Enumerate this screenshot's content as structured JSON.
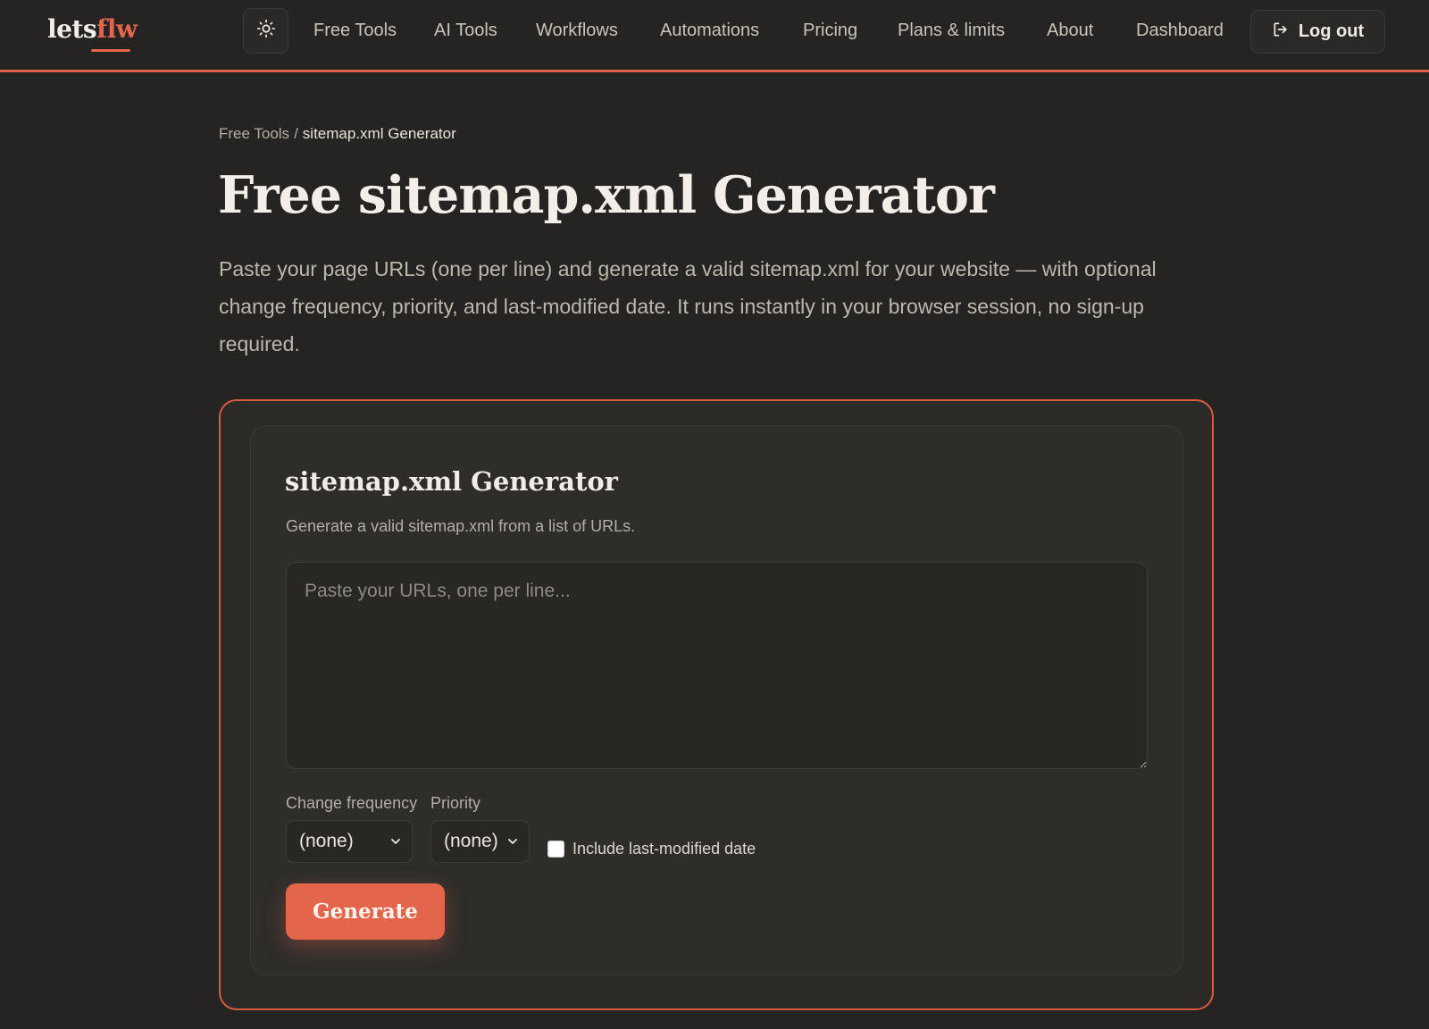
{
  "header": {
    "logo": {
      "part1": "lets",
      "part2": "flw"
    },
    "theme_toggle_icon": "sun-icon",
    "nav": [
      {
        "label": "Free Tools"
      },
      {
        "label": "AI Tools"
      },
      {
        "label": "Workflows"
      },
      {
        "label": "Automations"
      },
      {
        "label": "Pricing"
      },
      {
        "label": "Plans & limits"
      },
      {
        "label": "About"
      },
      {
        "label": "Dashboard"
      }
    ],
    "logout": {
      "label": "Log out",
      "icon": "logout-icon"
    }
  },
  "breadcrumb": {
    "parent": "Free Tools",
    "separator": "/",
    "current": "sitemap.xml Generator"
  },
  "page": {
    "title": "Free sitemap.xml Generator",
    "intro": "Paste your page URLs (one per line) and generate a valid sitemap.xml for your website — with optional change frequency, priority, and last-modified date. It runs instantly in your browser session, no sign-up required."
  },
  "tool": {
    "title": "sitemap.xml Generator",
    "subtitle": "Generate a valid sitemap.xml from a list of URLs.",
    "urls_placeholder": "Paste your URLs, one per line...",
    "urls_value": "",
    "change_frequency": {
      "label": "Change frequency",
      "selected": "(none)"
    },
    "priority": {
      "label": "Priority",
      "selected": "(none)"
    },
    "lastmod": {
      "label": "Include last-modified date",
      "checked": false
    },
    "generate_label": "Generate"
  },
  "colors": {
    "accent": "#e3654c",
    "background": "#252422",
    "card": "#2e2d2a",
    "text": "#e8e4dc",
    "muted": "#b3aea5"
  }
}
